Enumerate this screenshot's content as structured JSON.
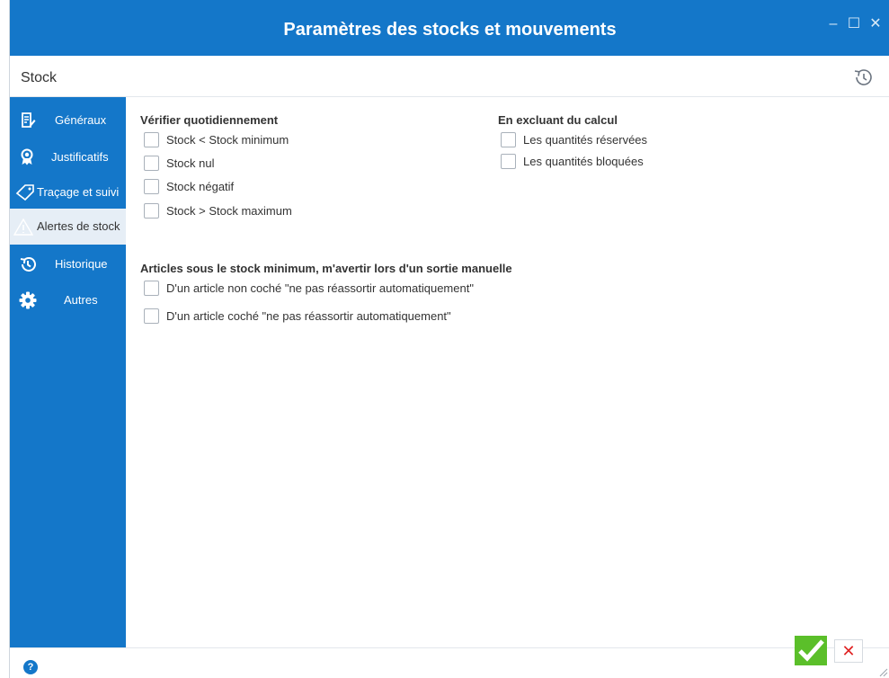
{
  "window": {
    "title": "Paramètres des stocks et mouvements",
    "minimize_glyph": "–",
    "maximize_glyph": "☐",
    "close_glyph": "✕"
  },
  "subheader": {
    "title": "Stock",
    "history_icon": "history-icon"
  },
  "sidebar": {
    "items": [
      {
        "label": "Généraux",
        "icon": "document-edit-icon",
        "active": false
      },
      {
        "label": "Justificatifs",
        "icon": "award-ribbon-icon",
        "active": false
      },
      {
        "label": "Traçage et suivi",
        "icon": "tag-icon",
        "active": false
      },
      {
        "label": "Alertes de stock",
        "icon": "warning-icon",
        "active": true
      },
      {
        "label": "Historique",
        "icon": "history-icon",
        "active": false
      },
      {
        "label": "Autres",
        "icon": "gear-icon",
        "active": false
      }
    ]
  },
  "main": {
    "daily_check": {
      "title": "Vérifier quotidiennement",
      "options": [
        {
          "label": "Stock < Stock minimum",
          "checked": false
        },
        {
          "label": "Stock nul",
          "checked": false
        },
        {
          "label": "Stock négatif",
          "checked": false
        },
        {
          "label": "Stock > Stock maximum",
          "checked": false
        }
      ]
    },
    "exclusions": {
      "title": "En excluant du calcul",
      "options": [
        {
          "label": "Les quantités réservées",
          "checked": false
        },
        {
          "label": "Les quantités bloquées",
          "checked": false
        }
      ]
    },
    "manual_exit": {
      "title": "Articles sous le stock minimum, m'avertir lors d'un sortie manuelle",
      "options": [
        {
          "label": "D'un article non coché \"ne pas réassortir automatiquement\"",
          "checked": false
        },
        {
          "label": "D'un article coché \"ne pas réassortir automatiquement\"",
          "checked": false
        }
      ]
    }
  },
  "footer": {
    "help_glyph": "?",
    "cancel_glyph": "✕"
  },
  "colors": {
    "primary": "#1477c9",
    "active_item_bg": "#e6eef6",
    "ok_green": "#5bbf2a",
    "cancel_red": "#e02424"
  }
}
